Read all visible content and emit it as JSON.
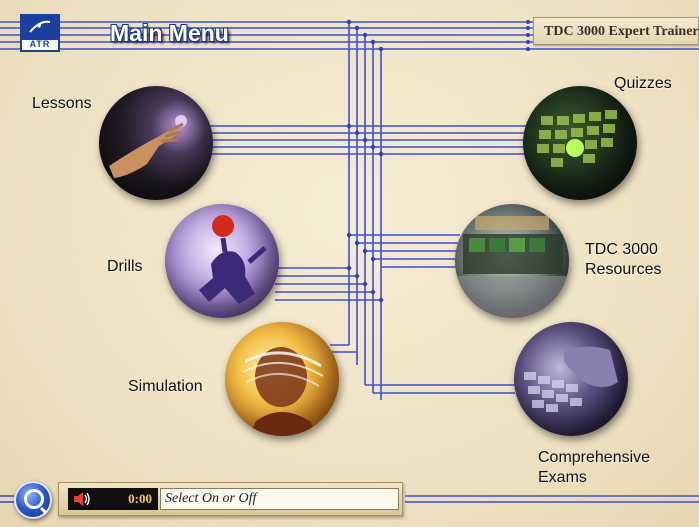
{
  "header": {
    "logo_text": "ATR",
    "title": "Main Menu",
    "product_title": "TDC 3000 Expert Trainer"
  },
  "menu": {
    "lessons": "Lessons",
    "drills": "Drills",
    "simulation": "Simulation",
    "quizzes": "Quizzes",
    "resources_line1": "TDC 3000",
    "resources_line2": "Resources",
    "exams_line1": "Comprehensive",
    "exams_line2": "Exams"
  },
  "status_bar": {
    "time": "0:00",
    "prompt": "Select On or Off"
  },
  "icons": {
    "logo": "atr-logo-icon",
    "home": "search-globe-icon",
    "audio": "speaker-icon"
  },
  "colors": {
    "wire": "#3a4fd8",
    "title_outline": "#163a8c",
    "background": "#efe3c6"
  }
}
